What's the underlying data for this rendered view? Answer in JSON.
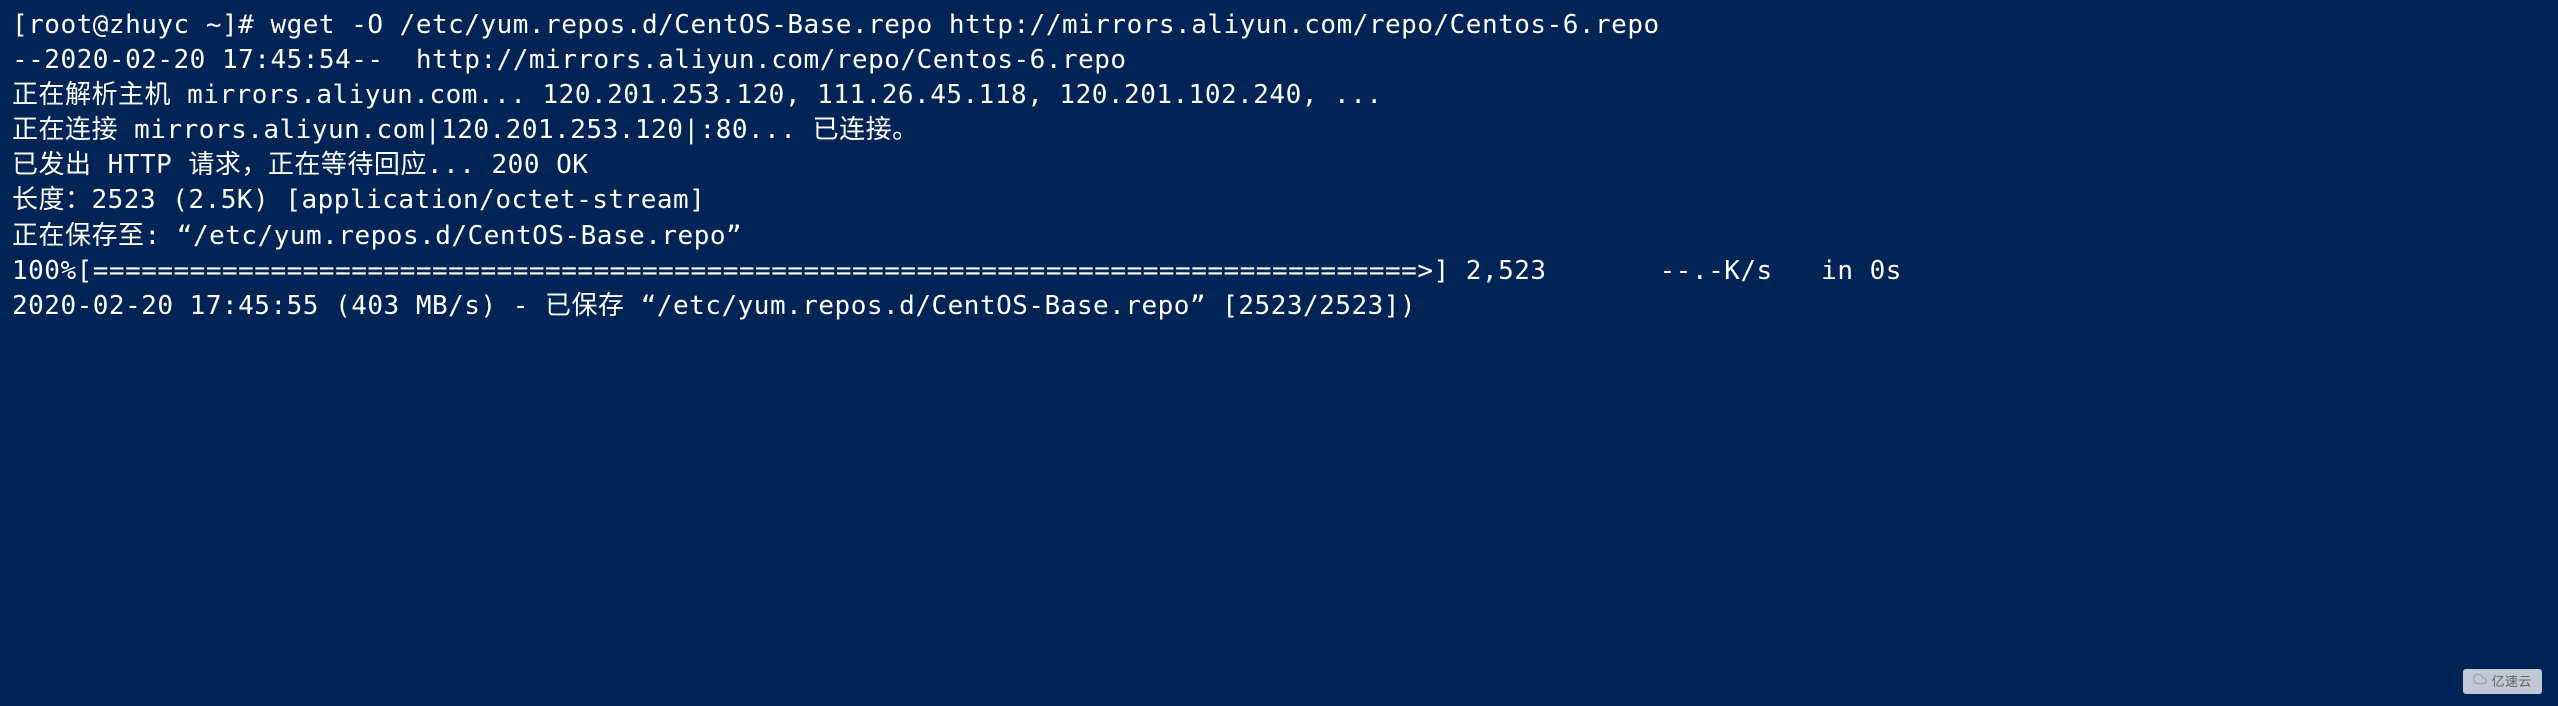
{
  "terminal": {
    "prompt_line": "[root@zhuyc ~]# wget -O /etc/yum.repos.d/CentOS-Base.repo http://mirrors.aliyun.com/repo/Centos-6.repo",
    "connect_line": "--2020-02-20 17:45:54--  http://mirrors.aliyun.com/repo/Centos-6.repo",
    "resolving_line": "正在解析主机 mirrors.aliyun.com... 120.201.253.120, 111.26.45.118, 120.201.102.240, ...",
    "connecting_line": "正在连接 mirrors.aliyun.com|120.201.253.120|:80... 已连接。",
    "http_request_line": "已发出 HTTP 请求，正在等待回应... 200 OK",
    "length_line": "长度：2523 (2.5K) [application/octet-stream]",
    "saving_line": "正在保存至: “/etc/yum.repos.d/CentOS-Base.repo”",
    "blank1": "",
    "progress_line": "100%[==================================================================================>] 2,523       --.-K/s   in 0s",
    "blank2": "",
    "saved_line": "2020-02-20 17:45:55 (403 MB/s) - 已保存 “/etc/yum.repos.d/CentOS-Base.repo” [2523/2523])"
  },
  "watermark": {
    "text": "亿速云"
  }
}
